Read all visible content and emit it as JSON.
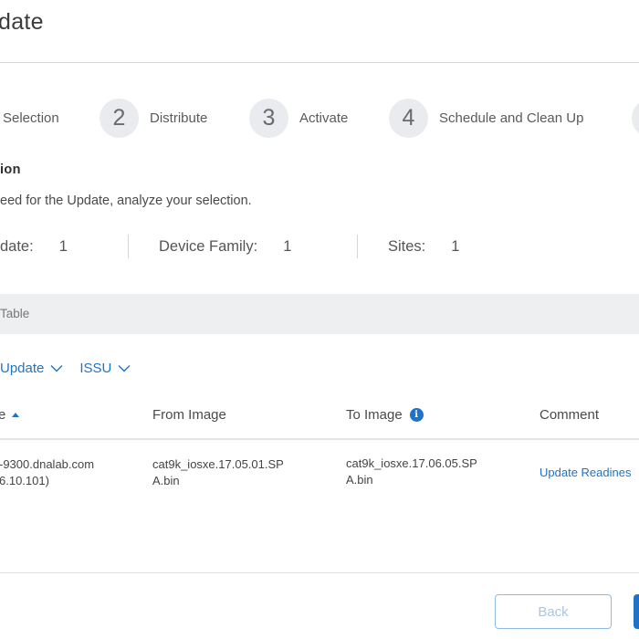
{
  "page": {
    "title": "date"
  },
  "stepper": {
    "steps": [
      {
        "number": "",
        "label": "Selection"
      },
      {
        "number": "2",
        "label": "Distribute"
      },
      {
        "number": "3",
        "label": "Activate"
      },
      {
        "number": "4",
        "label": "Schedule and Clean Up"
      }
    ]
  },
  "section": {
    "heading": "ion",
    "description": "eed for the Update, analyze your selection."
  },
  "summary": {
    "items": [
      {
        "label": "date:",
        "value": "1"
      },
      {
        "label": "Device Family:",
        "value": "1"
      },
      {
        "label": "Sites:",
        "value": "1"
      }
    ]
  },
  "table": {
    "banner_label": "Table",
    "filters": [
      {
        "label": "Update"
      },
      {
        "label": "ISSU"
      }
    ],
    "columns": [
      {
        "label": "e"
      },
      {
        "label": "From Image"
      },
      {
        "label": "To Image"
      },
      {
        "label": "Comment"
      }
    ],
    "rows": [
      {
        "device_line1": "-9300.dnalab.com",
        "device_line2": "6.10.101)",
        "from_line1": "cat9k_iosxe.17.05.01.SP",
        "from_line2": "A.bin",
        "to_line1": "cat9k_iosxe.17.06.05.SP",
        "to_line2": "A.bin",
        "comment": "Update Readines"
      }
    ]
  },
  "footer": {
    "back_label": "Back"
  },
  "colors": {
    "accent": "#1f73c7",
    "step_circle": "#e9ebee",
    "banner": "#eeeff1"
  },
  "icons": {
    "sort": "sort-ascending-icon",
    "info": "info-icon",
    "dropdown": "chevron-down-icon"
  }
}
